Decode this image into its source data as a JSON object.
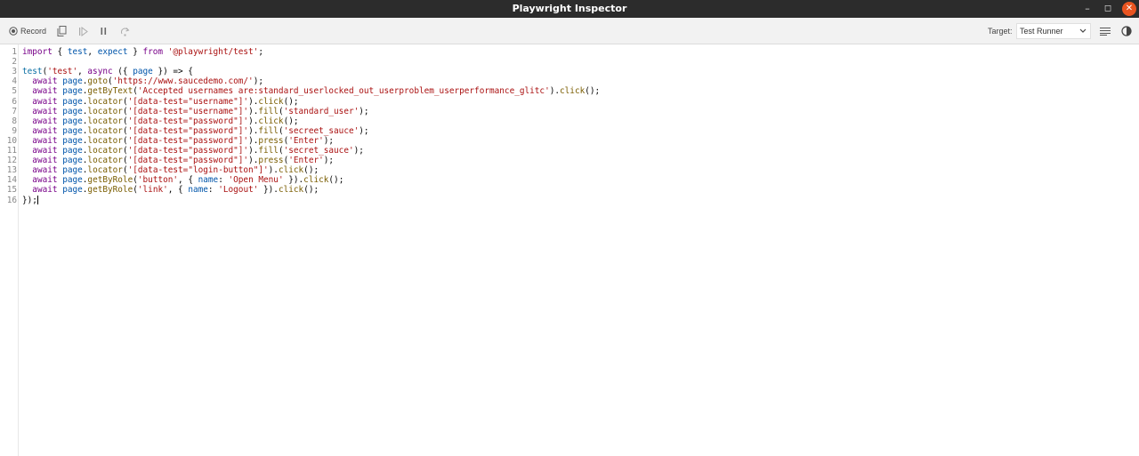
{
  "window": {
    "title": "Playwright Inspector",
    "controls": {
      "minimize": "–",
      "maximize": "◻",
      "close": "✕"
    }
  },
  "toolbar": {
    "record_label": "Record",
    "target_label": "Target:",
    "target_value": "Test Runner",
    "icons": [
      "record-icon",
      "copy-icon",
      "resume-icon",
      "pause-icon",
      "step-over-icon",
      "chevron-down-icon",
      "lines-icon",
      "theme-toggle-icon"
    ]
  },
  "editor": {
    "lines": [
      {
        "n": "1",
        "tokens": [
          [
            "kw",
            "import"
          ],
          [
            "p",
            " { "
          ],
          [
            "var",
            "test"
          ],
          [
            "p",
            ", "
          ],
          [
            "var",
            "expect"
          ],
          [
            "p",
            " } "
          ],
          [
            "kw",
            "from"
          ],
          [
            "p",
            " "
          ],
          [
            "str",
            "'@playwright/test'"
          ],
          [
            "p",
            ";"
          ]
        ]
      },
      {
        "n": "2",
        "tokens": []
      },
      {
        "n": "3",
        "tokens": [
          [
            "fn",
            "test"
          ],
          [
            "p",
            "("
          ],
          [
            "str",
            "'test'"
          ],
          [
            "p",
            ", "
          ],
          [
            "kw",
            "async"
          ],
          [
            "p",
            " ({ "
          ],
          [
            "var",
            "page"
          ],
          [
            "p",
            " }) => {"
          ]
        ]
      },
      {
        "n": "4",
        "tokens": [
          [
            "p",
            "  "
          ],
          [
            "kw",
            "await"
          ],
          [
            "p",
            " "
          ],
          [
            "var",
            "page"
          ],
          [
            "p",
            "."
          ],
          [
            "mth",
            "goto"
          ],
          [
            "p",
            "("
          ],
          [
            "str",
            "'https://www.saucedemo.com/'"
          ],
          [
            "p",
            ");"
          ]
        ]
      },
      {
        "n": "5",
        "tokens": [
          [
            "p",
            "  "
          ],
          [
            "kw",
            "await"
          ],
          [
            "p",
            " "
          ],
          [
            "var",
            "page"
          ],
          [
            "p",
            "."
          ],
          [
            "mth",
            "getByText"
          ],
          [
            "p",
            "("
          ],
          [
            "str",
            "'Accepted usernames are:standard_userlocked_out_userproblem_userperformance_glitc'"
          ],
          [
            "p",
            ")."
          ],
          [
            "mth",
            "click"
          ],
          [
            "p",
            "();"
          ]
        ]
      },
      {
        "n": "6",
        "tokens": [
          [
            "p",
            "  "
          ],
          [
            "kw",
            "await"
          ],
          [
            "p",
            " "
          ],
          [
            "var",
            "page"
          ],
          [
            "p",
            "."
          ],
          [
            "mth",
            "locator"
          ],
          [
            "p",
            "("
          ],
          [
            "str",
            "'[data-test=\"username\"]'"
          ],
          [
            "p",
            ")."
          ],
          [
            "mth",
            "click"
          ],
          [
            "p",
            "();"
          ]
        ]
      },
      {
        "n": "7",
        "tokens": [
          [
            "p",
            "  "
          ],
          [
            "kw",
            "await"
          ],
          [
            "p",
            " "
          ],
          [
            "var",
            "page"
          ],
          [
            "p",
            "."
          ],
          [
            "mth",
            "locator"
          ],
          [
            "p",
            "("
          ],
          [
            "str",
            "'[data-test=\"username\"]'"
          ],
          [
            "p",
            ")."
          ],
          [
            "mth",
            "fill"
          ],
          [
            "p",
            "("
          ],
          [
            "str",
            "'standard_user'"
          ],
          [
            "p",
            ");"
          ]
        ]
      },
      {
        "n": "8",
        "tokens": [
          [
            "p",
            "  "
          ],
          [
            "kw",
            "await"
          ],
          [
            "p",
            " "
          ],
          [
            "var",
            "page"
          ],
          [
            "p",
            "."
          ],
          [
            "mth",
            "locator"
          ],
          [
            "p",
            "("
          ],
          [
            "str",
            "'[data-test=\"password\"]'"
          ],
          [
            "p",
            ")."
          ],
          [
            "mth",
            "click"
          ],
          [
            "p",
            "();"
          ]
        ]
      },
      {
        "n": "9",
        "tokens": [
          [
            "p",
            "  "
          ],
          [
            "kw",
            "await"
          ],
          [
            "p",
            " "
          ],
          [
            "var",
            "page"
          ],
          [
            "p",
            "."
          ],
          [
            "mth",
            "locator"
          ],
          [
            "p",
            "("
          ],
          [
            "str",
            "'[data-test=\"password\"]'"
          ],
          [
            "p",
            ")."
          ],
          [
            "mth",
            "fill"
          ],
          [
            "p",
            "("
          ],
          [
            "str",
            "'secreet_sauce'"
          ],
          [
            "p",
            ");"
          ]
        ]
      },
      {
        "n": "10",
        "tokens": [
          [
            "p",
            "  "
          ],
          [
            "kw",
            "await"
          ],
          [
            "p",
            " "
          ],
          [
            "var",
            "page"
          ],
          [
            "p",
            "."
          ],
          [
            "mth",
            "locator"
          ],
          [
            "p",
            "("
          ],
          [
            "str",
            "'[data-test=\"password\"]'"
          ],
          [
            "p",
            ")."
          ],
          [
            "mth",
            "press"
          ],
          [
            "p",
            "("
          ],
          [
            "str",
            "'Enter'"
          ],
          [
            "p",
            ");"
          ]
        ]
      },
      {
        "n": "11",
        "tokens": [
          [
            "p",
            "  "
          ],
          [
            "kw",
            "await"
          ],
          [
            "p",
            " "
          ],
          [
            "var",
            "page"
          ],
          [
            "p",
            "."
          ],
          [
            "mth",
            "locator"
          ],
          [
            "p",
            "("
          ],
          [
            "str",
            "'[data-test=\"password\"]'"
          ],
          [
            "p",
            ")."
          ],
          [
            "mth",
            "fill"
          ],
          [
            "p",
            "("
          ],
          [
            "str",
            "'secret_sauce'"
          ],
          [
            "p",
            ");"
          ]
        ]
      },
      {
        "n": "12",
        "tokens": [
          [
            "p",
            "  "
          ],
          [
            "kw",
            "await"
          ],
          [
            "p",
            " "
          ],
          [
            "var",
            "page"
          ],
          [
            "p",
            "."
          ],
          [
            "mth",
            "locator"
          ],
          [
            "p",
            "("
          ],
          [
            "str",
            "'[data-test=\"password\"]'"
          ],
          [
            "p",
            ")."
          ],
          [
            "mth",
            "press"
          ],
          [
            "p",
            "("
          ],
          [
            "str",
            "'Enter'"
          ],
          [
            "p",
            ");"
          ]
        ]
      },
      {
        "n": "13",
        "tokens": [
          [
            "p",
            "  "
          ],
          [
            "kw",
            "await"
          ],
          [
            "p",
            " "
          ],
          [
            "var",
            "page"
          ],
          [
            "p",
            "."
          ],
          [
            "mth",
            "locator"
          ],
          [
            "p",
            "("
          ],
          [
            "str",
            "'[data-test=\"login-button\"]'"
          ],
          [
            "p",
            ")."
          ],
          [
            "mth",
            "click"
          ],
          [
            "p",
            "();"
          ]
        ]
      },
      {
        "n": "14",
        "tokens": [
          [
            "p",
            "  "
          ],
          [
            "kw",
            "await"
          ],
          [
            "p",
            " "
          ],
          [
            "var",
            "page"
          ],
          [
            "p",
            "."
          ],
          [
            "mth",
            "getByRole"
          ],
          [
            "p",
            "("
          ],
          [
            "str",
            "'button'"
          ],
          [
            "p",
            ", { "
          ],
          [
            "var",
            "name"
          ],
          [
            "p",
            ": "
          ],
          [
            "str",
            "'Open Menu'"
          ],
          [
            "p",
            " })."
          ],
          [
            "mth",
            "click"
          ],
          [
            "p",
            "();"
          ]
        ]
      },
      {
        "n": "15",
        "tokens": [
          [
            "p",
            "  "
          ],
          [
            "kw",
            "await"
          ],
          [
            "p",
            " "
          ],
          [
            "var",
            "page"
          ],
          [
            "p",
            "."
          ],
          [
            "mth",
            "getByRole"
          ],
          [
            "p",
            "("
          ],
          [
            "str",
            "'link'"
          ],
          [
            "p",
            ", { "
          ],
          [
            "var",
            "name"
          ],
          [
            "p",
            ": "
          ],
          [
            "str",
            "'Logout'"
          ],
          [
            "p",
            " })."
          ],
          [
            "mth",
            "click"
          ],
          [
            "p",
            "();"
          ]
        ]
      },
      {
        "n": "16",
        "tokens": [
          [
            "p",
            "});"
          ]
        ]
      }
    ]
  }
}
